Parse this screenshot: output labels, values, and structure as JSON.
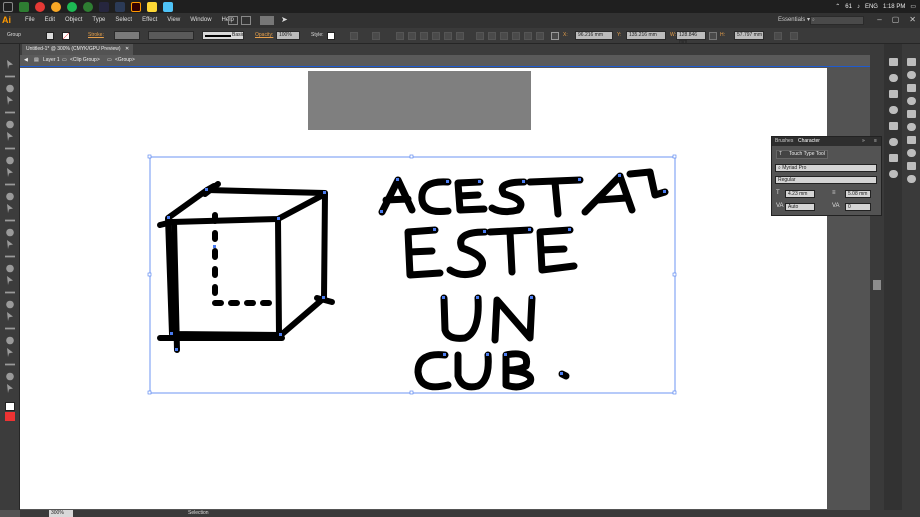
{
  "taskbar": {
    "tray": {
      "battery": "61",
      "language": "ENG",
      "time": "1:18 PM"
    }
  },
  "menubar": {
    "logo": "Ai",
    "items": [
      "File",
      "Edit",
      "Object",
      "Type",
      "Select",
      "Effect",
      "View",
      "Window",
      "Help"
    ],
    "workspace": "Essentials",
    "workspace_arrow": "▾",
    "win_min": "–",
    "win_max": "▢",
    "win_close": "✕"
  },
  "controlbar": {
    "selection_label": "Group",
    "stroke_label": "Stroke:",
    "brush_label": "Basic",
    "opacity_label": "Opacity:",
    "opacity": "100%",
    "style_label": "Style:",
    "x_label": "X:",
    "x": "96.216 mm",
    "y_label": "Y:",
    "y": "135.216 mm",
    "w_label": "W:",
    "w": "128.846 mm",
    "h_label": "H:",
    "h": "57.797 mm"
  },
  "document": {
    "tab_title": "Untitled-1* @ 300% (CMYK/GPU Preview)",
    "tab_close": "✕",
    "crumbs": [
      "Layer 1",
      "<Clip Group>",
      "<Group>"
    ]
  },
  "character_panel": {
    "tabs": [
      "Brushes",
      "Character"
    ],
    "touch_type": "Touch Type Tool",
    "font": "Myriad Pro",
    "style": "Regular",
    "size": "4.23 mm",
    "leading": "5.08 mm",
    "kerning": "Auto",
    "tracking": "0"
  },
  "status": {
    "zoom": "300%",
    "tool": "Selection"
  },
  "colors": {
    "accent": "#1e5bd1",
    "chrome": "#323232",
    "artboard": "#ffffff"
  }
}
